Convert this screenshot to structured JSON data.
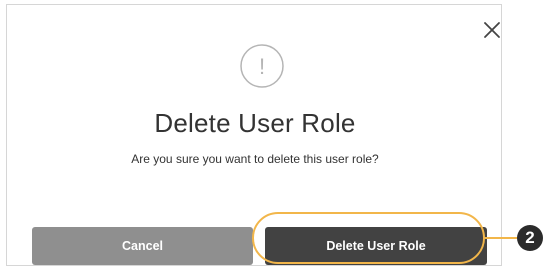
{
  "dialog": {
    "title": "Delete User Role",
    "message": "Are you sure you want to delete this user role?",
    "close_icon": "close-icon",
    "warning_icon": "exclamation-circle-icon",
    "warning_glyph": "!",
    "buttons": {
      "cancel_label": "Cancel",
      "delete_label": "Delete User Role"
    }
  },
  "callout": {
    "step_number": "2",
    "highlight_color": "#f2b64a"
  },
  "colors": {
    "cancel_button": "#8f8f8f",
    "delete_button": "#424242",
    "badge": "#2b2b2b"
  }
}
